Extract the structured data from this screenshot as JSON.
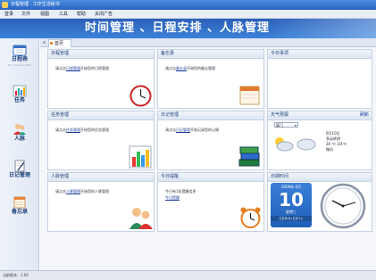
{
  "window": {
    "title": "日程管理 · 工作生活秘书"
  },
  "menu": {
    "items": [
      "登录",
      "文件",
      "视图",
      "工具",
      "帮助",
      "关闭广告"
    ]
  },
  "banner": {
    "title": "时间管理 、日程安排 、人脉管理"
  },
  "sidebar": {
    "items": [
      {
        "label": "日程表",
        "sub": "My Schedule Plan"
      },
      {
        "label": "任务",
        "sub": ""
      },
      {
        "label": "人脉",
        "sub": ""
      },
      {
        "label": "日记管理",
        "sub": ""
      },
      {
        "label": "备忘录",
        "sub": ""
      }
    ]
  },
  "tabs": [
    {
      "label": "首页",
      "close": "x"
    }
  ],
  "panels": {
    "schedule": {
      "title": "日程管理",
      "desc_pre": "请点击",
      "link": "日程管理",
      "desc_post": "开始您的日程管理"
    },
    "memo": {
      "title": "备忘录",
      "desc_pre": "请点击",
      "link": "备忘录",
      "desc_post": "开始您的备忘管理"
    },
    "today": {
      "title": "今日事项"
    },
    "task": {
      "title": "任务管理",
      "desc_pre": "请点击",
      "link": "任务管理",
      "desc_post": "开始您的任务管理"
    },
    "diary": {
      "title": "日记管理",
      "desc_pre": "请点击",
      "link": "日记管理",
      "desc_post": "开始记录您的心情"
    },
    "weather": {
      "title": "天气预报",
      "refresh": "刷新",
      "city": "厦门",
      "date": "6月10日",
      "condition": "多云转阴",
      "temp": "30 ℃ /24℃",
      "wind": "微风"
    },
    "contacts": {
      "title": "人脉管理",
      "desc_pre": "请点击",
      "link": "人脉管理",
      "desc_post": "开始您的人脉管理"
    },
    "reminder": {
      "title": "今日提醒",
      "line1": "今日有1条提醒信息",
      "link": "今日提醒"
    },
    "datetime": {
      "title": "日期时间",
      "month": "2009年 6月",
      "day": "10",
      "weekday": "星期三",
      "lunar": "己丑年(牛) 五月十八"
    }
  },
  "status": {
    "text": "当前版本：1.02"
  },
  "colors": {
    "banner": "#2c5fb8",
    "accent": "#1d3f7a",
    "calendar": "#2a6cc8"
  }
}
